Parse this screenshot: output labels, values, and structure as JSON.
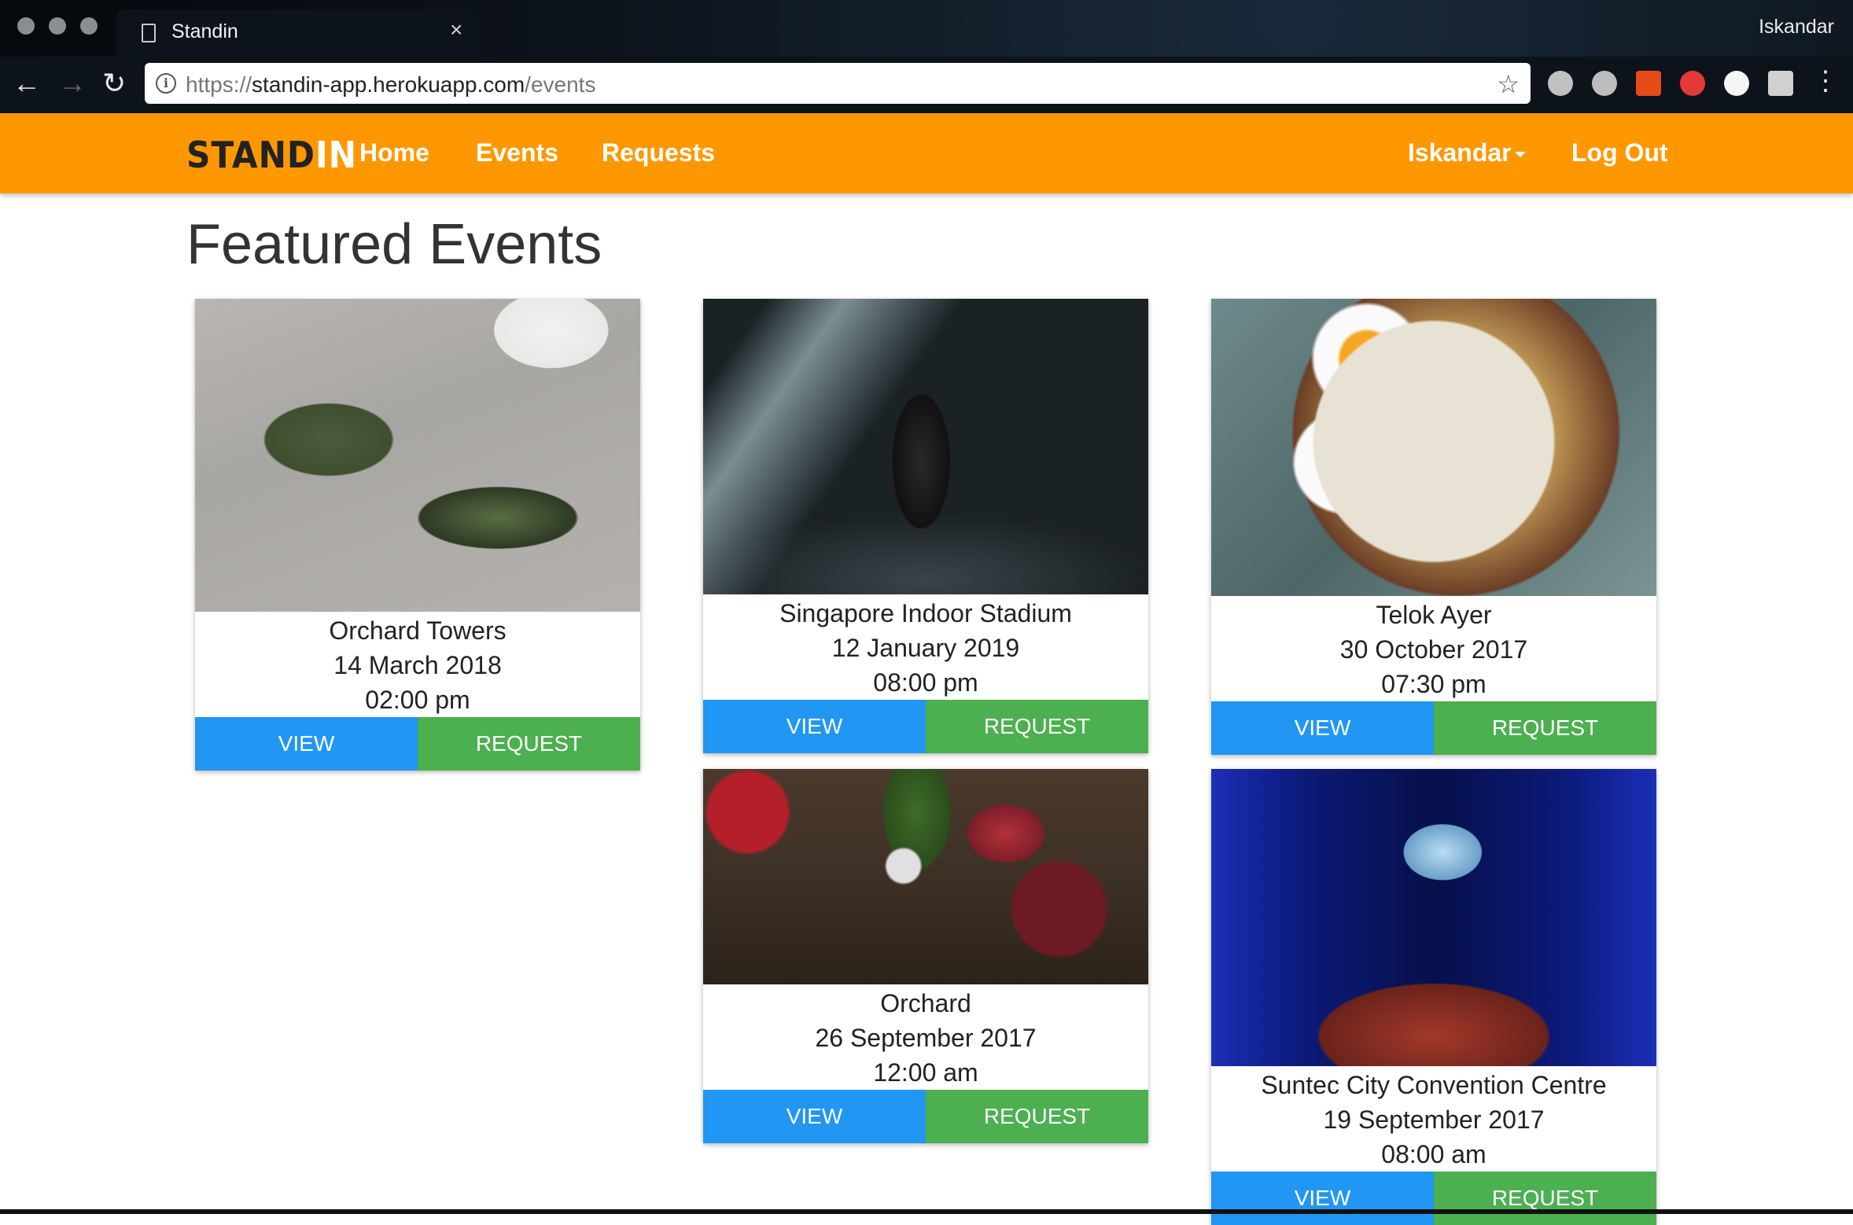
{
  "browser": {
    "tab_title": "Standin",
    "profile_name": "Iskandar",
    "url_scheme": "https://",
    "url_host": "standin-app.herokuapp.com",
    "url_path": "/events",
    "extension_colors": [
      "#c0c0c0",
      "#bdbdbd",
      "#e64a19",
      "#e53935",
      "#f5f5f5",
      "#d0d0d0"
    ]
  },
  "nav": {
    "brand_stand": "STAND",
    "brand_in": "IN",
    "links": [
      "Home",
      "Events",
      "Requests"
    ],
    "user_menu": "Iskandar",
    "logout": "Log Out",
    "accent": "#ff9800"
  },
  "page": {
    "title": "Featured Events"
  },
  "events": [
    {
      "venue": "Orchard Towers",
      "date": "14 March 2018",
      "time": "02:00 pm",
      "image": "sneakers-photo"
    },
    {
      "venue": "Singapore Indoor Stadium",
      "date": "12 January 2019",
      "time": "08:00 pm",
      "image": "concert-photo"
    },
    {
      "venue": "Telok Ayer",
      "date": "30 October 2017",
      "time": "07:30 pm",
      "image": "ramen-photo"
    },
    {
      "venue": "Orchard",
      "date": "26 September 2017",
      "time": "12:00 am",
      "image": "spices-photo"
    },
    {
      "venue": "Suntec City Convention Centre",
      "date": "19 September 2017",
      "time": "08:00 am",
      "image": "convention-photo"
    }
  ],
  "buttons": {
    "view": "VIEW",
    "request": "REQUEST",
    "view_color": "#2196f3",
    "request_color": "#4caf50"
  }
}
